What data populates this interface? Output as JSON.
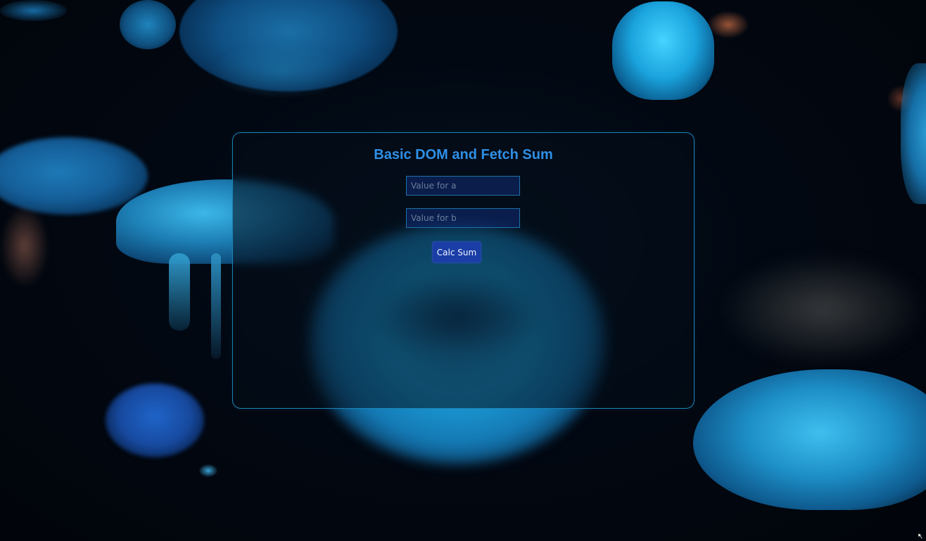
{
  "page": {
    "title": "Basic DOM and Fetch Sum"
  },
  "form": {
    "input_a": {
      "value": "",
      "placeholder": "Value for a"
    },
    "input_b": {
      "value": "",
      "placeholder": "Value for b"
    },
    "submit_label": "Calc Sum"
  },
  "background": {
    "description_icon": "jellyfish-background",
    "accent_color": "#1b9ad4"
  },
  "colors": {
    "title": "#2f8fe6",
    "card_border": "#1b83b4",
    "button_bg": "#1b3ea6",
    "input_bg": "#102a6e"
  }
}
